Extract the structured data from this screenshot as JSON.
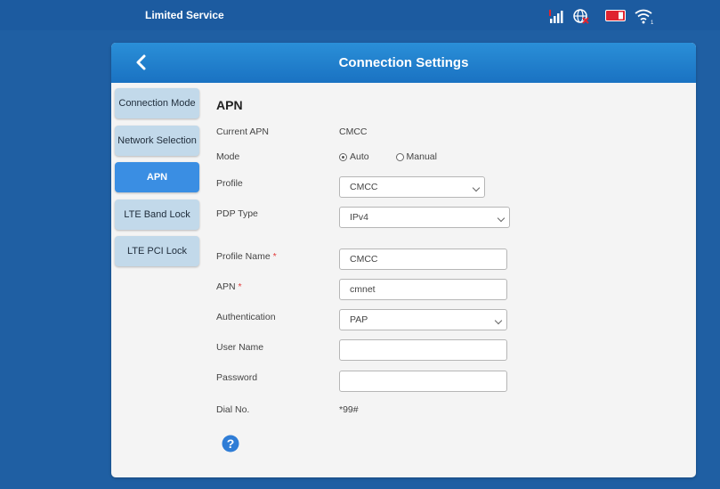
{
  "status_bar": {
    "service_text": "Limited Service",
    "icons": [
      "signal-strength-icon",
      "globe-roaming-icon",
      "sim-card-icon",
      "wifi-icon"
    ],
    "accent_color": "#e0242f"
  },
  "header": {
    "title": "Connection Settings",
    "back_icon": "chevron-left-icon"
  },
  "sidebar": {
    "items": [
      {
        "label": "Connection Mode",
        "active": false
      },
      {
        "label": "Network Selection",
        "active": false
      },
      {
        "label": "APN",
        "active": true
      },
      {
        "label": "LTE Band Lock",
        "active": false
      },
      {
        "label": "LTE PCI Lock",
        "active": false
      }
    ]
  },
  "form": {
    "section_title": "APN",
    "current_apn": {
      "label": "Current APN",
      "value": "CMCC"
    },
    "mode": {
      "label": "Mode",
      "options": [
        "Auto",
        "Manual"
      ],
      "selected": "Auto"
    },
    "profile": {
      "label": "Profile",
      "value": "CMCC"
    },
    "pdp_type": {
      "label": "PDP Type",
      "value": "IPv4"
    },
    "profile_name": {
      "label": "Profile Name",
      "required_mark": "*",
      "value": "CMCC"
    },
    "apn": {
      "label": "APN",
      "required_mark": "*",
      "value": "cmnet"
    },
    "authentication": {
      "label": "Authentication",
      "value": "PAP"
    },
    "user_name": {
      "label": "User Name",
      "value": ""
    },
    "password": {
      "label": "Password",
      "value": ""
    },
    "dial_no": {
      "label": "Dial No.",
      "value": "*99#"
    },
    "help_icon": "question-mark-icon"
  }
}
